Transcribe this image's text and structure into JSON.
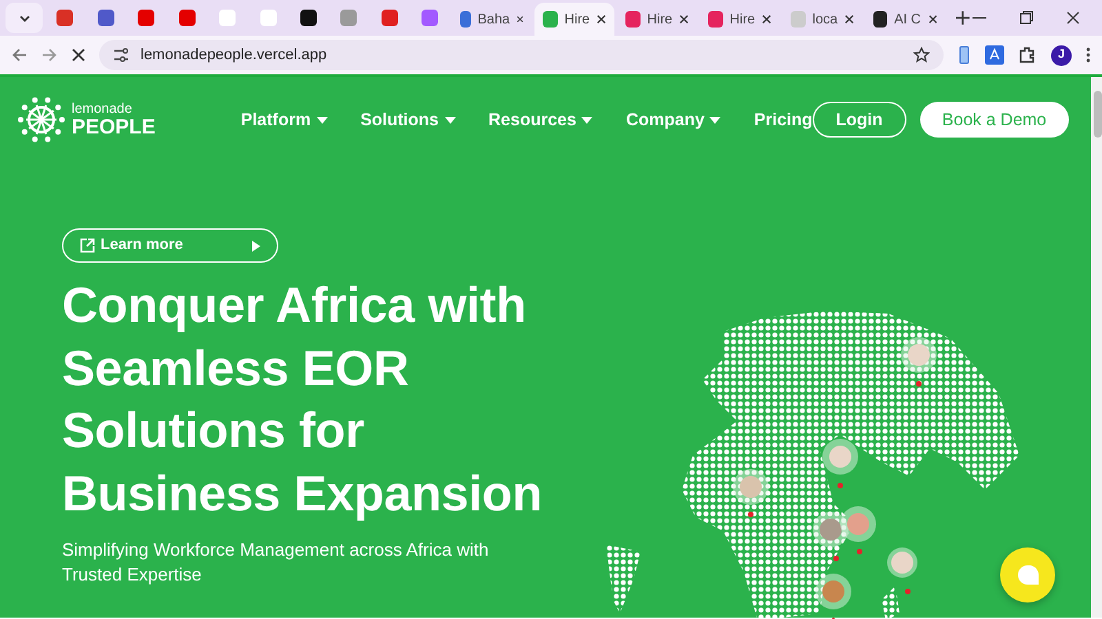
{
  "browser": {
    "pinned_tabs": [
      {
        "selected": false
      },
      {
        "selected": false
      },
      {
        "selected": false
      },
      {
        "selected": false
      },
      {
        "selected": false
      },
      {
        "selected": false
      },
      {
        "selected": false
      },
      {
        "selected": false
      },
      {
        "selected": false
      },
      {
        "selected": false
      }
    ],
    "tabs": [
      {
        "title": "Baha",
        "selected": false
      },
      {
        "title": "Hire",
        "selected": true
      },
      {
        "title": "Hire",
        "selected": false
      },
      {
        "title": "Hire",
        "selected": false
      },
      {
        "title": "loca",
        "selected": false
      },
      {
        "title": "AI C",
        "selected": false
      }
    ],
    "address": "lemonadepeople.vercel.app",
    "profile": "J"
  },
  "logo": {
    "line1": "lemonade",
    "line2": "PEOPLE"
  },
  "nav": [
    {
      "label": "Platform",
      "dropdown": true
    },
    {
      "label": "Solutions",
      "dropdown": true
    },
    {
      "label": "Resources",
      "dropdown": true
    },
    {
      "label": "Company",
      "dropdown": true
    },
    {
      "label": "Pricing",
      "dropdown": false
    }
  ],
  "login": "Login",
  "demo": "Book a Demo",
  "hero": {
    "pill": "Learn more",
    "title_lines": [
      "Conquer Africa with",
      "Seamless EOR",
      "Solutions for",
      "Business Expansion"
    ],
    "subtitle": "Simplifying Workforce Management across Africa with Trusted Expertise"
  }
}
